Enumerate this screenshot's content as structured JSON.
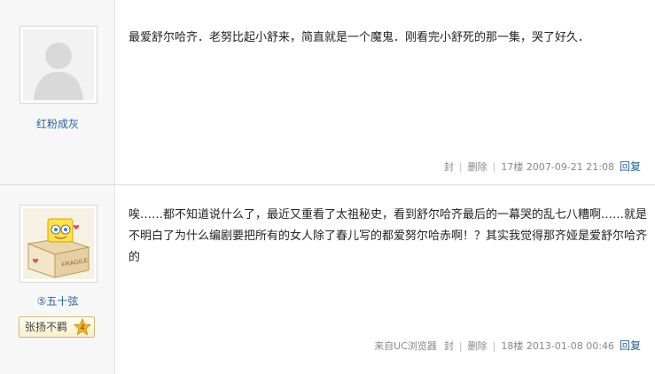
{
  "posts": [
    {
      "username": "红粉成灰",
      "avatar": "default-avatar",
      "content": "最爱舒尔哈齐．老努比起小舒来，简直就是一个魔鬼．刚看完小舒死的那一集，哭了好久．",
      "actions": {
        "feng": "封",
        "delete": "删除",
        "reply": "回复"
      },
      "floor": "17楼",
      "time": "2007-09-21 21:08"
    },
    {
      "username": "⑤五十弦",
      "avatar": "spongebob-box-avatar",
      "badge": {
        "label": "张扬不羁",
        "level": "4"
      },
      "content": "唉……都不知道说什么了，最近又重看了太祖秘史，看到舒尔哈齐最后的一幕哭的乱七八糟啊……就是不明白了为什么编剧要把所有的女人除了春儿写的都爱努尔哈赤啊！？其实我觉得那齐娅是爱舒尔哈齐的",
      "source": "来自UC浏览器",
      "actions": {
        "feng": "封",
        "delete": "删除",
        "reply": "回复"
      },
      "floor": "18楼",
      "time": "2013-01-08 00:46"
    }
  ],
  "colors": {
    "link": "#26619a",
    "meta": "#888888",
    "sidebar": "#f7f7f7"
  }
}
